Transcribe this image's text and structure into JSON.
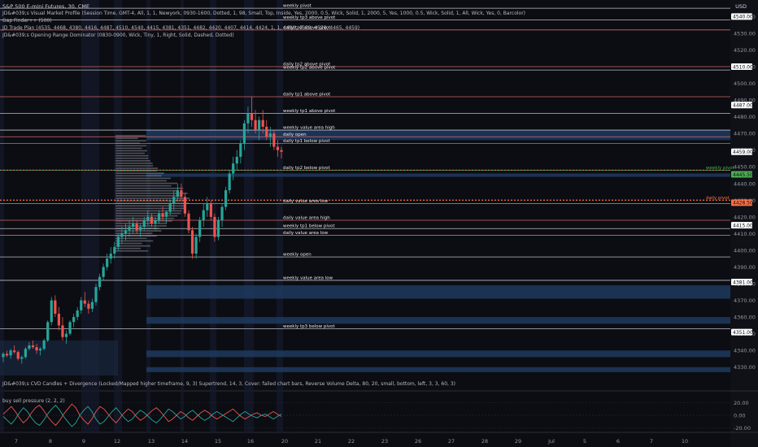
{
  "header": {
    "title": "S&P 500 E-mini Futures, 30, CME",
    "currency": "USD",
    "indicators": [
      "JD&#039;s Visual Market Profile (Session Time, GMT-4, All, 1, 1, Newyork, 0930-1600, Dotted, 1, 98, Small, Top, Inside, Yes, 2000, 0.5, Wick, Solid, 1, 2000, 5, Yes, 1000, 0.5, Wick, Solid, 1, All, Wick, Yes, 0, Barcolor)",
      "Gap Finder++ (500)",
      "JD Trade Plan (4535, 4468, 4380, 4416, 4487, 4510, 4540, 4415, 4381, 4351, 4482, 4420, 4407, 4414, 4424, 1, 1, 4498, 4509, 4528, 4465, 4459)",
      "JD&#039;s Opening Range Dominator (0830-0900, Wick, Tiny, 1, Right, Solid, Dashed, Dotted)"
    ],
    "sub_indicator": "JD&#039;s CVD Candles + Divergence (Locked/Mapped higher timeframe, 9, 3) Supertrend, 14, 3, Cover: failed chart bars, Reverse Volume Delta, 80, 20, small, bottom, left, 3, 3, 60, 3)",
    "oscillator_title": "buy sell pressure (2, 2, 2)"
  },
  "colors": {
    "background": "#0b0d12",
    "bull": "#26a69a",
    "bear": "#ef5350",
    "accent_green": "#4caf50",
    "accent_orange": "#ff7043",
    "zone_blue": "#1e3a5f"
  },
  "chart_data": {
    "type": "candlestick",
    "title": "S&P 500 E-mini Futures, 30, CME",
    "x_ticks": [
      "7",
      "8",
      "9",
      "12",
      "13",
      "14",
      "15",
      "16",
      "20",
      "21",
      "22",
      "23",
      "26",
      "27",
      "28",
      "29",
      "Jul",
      "5",
      "6",
      "7",
      "10"
    ],
    "y_ticks": [
      4330,
      4340,
      4350,
      4360,
      4370,
      4380,
      4390,
      4400,
      4410,
      4420,
      4430,
      4440,
      4450,
      4460,
      4470,
      4480,
      4490,
      4500,
      4510,
      4520,
      4530,
      4540
    ],
    "ylim": [
      4325,
      4547
    ],
    "price_tags": [
      {
        "label": "4540.00",
        "value": 4540,
        "style": "white"
      },
      {
        "label": "4510.00",
        "value": 4510,
        "style": "white"
      },
      {
        "label": "4487.00",
        "value": 4487,
        "style": "white"
      },
      {
        "label": "4459.00",
        "value": 4459,
        "style": "white"
      },
      {
        "label": "4445.50",
        "value": 4445.5,
        "style": "green"
      },
      {
        "label": "4428.50",
        "value": 4428.5,
        "style": "orange"
      },
      {
        "label": "4415.00",
        "value": 4415,
        "style": "white"
      },
      {
        "label": "4381.00",
        "value": 4381,
        "style": "white"
      },
      {
        "label": "4351.00",
        "value": 4351,
        "style": "white"
      }
    ],
    "levels": [
      {
        "label": "weekly pivot",
        "value": 4545
      },
      {
        "label": "weekly tp3 above pivot",
        "value": 4538
      },
      {
        "label": "daily tp3 above pivot",
        "value": 4532
      },
      {
        "label": "daily tp2 above pivot",
        "value": 4510
      },
      {
        "label": "weekly tp2 above pivot",
        "value": 4508
      },
      {
        "label": "daily tp1 above pivot",
        "value": 4492
      },
      {
        "label": "weekly tp1 above pivot",
        "value": 4482
      },
      {
        "label": "weekly value area high",
        "value": 4472
      },
      {
        "label": "daily open",
        "value": 4468
      },
      {
        "label": "daily tp1 below pivot",
        "value": 4464
      },
      {
        "label": "daily tp2 below pivot",
        "value": 4448
      },
      {
        "label": "weekly pivot",
        "value": 4448,
        "side": "right",
        "color": "green"
      },
      {
        "label": "daily pivot",
        "value": 4430,
        "side": "right",
        "color": "orange"
      },
      {
        "label": "daily value area low",
        "value": 4428
      },
      {
        "label": "daily value area high",
        "value": 4418
      },
      {
        "label": "weekly tp1 below pivot",
        "value": 4413
      },
      {
        "label": "daily value area low",
        "value": 4409
      },
      {
        "label": "weekly open",
        "value": 4396
      },
      {
        "label": "weekly value area low",
        "value": 4382
      },
      {
        "label": "weekly tp3 below pivot",
        "value": 4353
      }
    ],
    "zones": [
      {
        "from": 4466,
        "to": 4472,
        "color": "blue"
      },
      {
        "from": 4444,
        "to": 4446,
        "color": "blue"
      },
      {
        "from": 4371,
        "to": 4379,
        "color": "blue"
      },
      {
        "from": 4356,
        "to": 4360,
        "color": "blue"
      },
      {
        "from": 4336,
        "to": 4340,
        "color": "blue"
      },
      {
        "from": 4327,
        "to": 4330,
        "color": "blue"
      }
    ],
    "candles": [
      [
        4336,
        4339,
        4333,
        4338
      ],
      [
        4338,
        4340,
        4336,
        4337
      ],
      [
        4337,
        4341,
        4335,
        4340
      ],
      [
        4340,
        4343,
        4338,
        4339
      ],
      [
        4339,
        4340,
        4334,
        4335
      ],
      [
        4335,
        4337,
        4332,
        4336
      ],
      [
        4336,
        4342,
        4335,
        4341
      ],
      [
        4341,
        4345,
        4340,
        4343
      ],
      [
        4343,
        4346,
        4341,
        4342
      ],
      [
        4342,
        4344,
        4338,
        4340
      ],
      [
        4340,
        4342,
        4337,
        4341
      ],
      [
        4341,
        4347,
        4340,
        4346
      ],
      [
        4346,
        4358,
        4345,
        4357
      ],
      [
        4357,
        4372,
        4355,
        4370
      ],
      [
        4370,
        4373,
        4360,
        4362
      ],
      [
        4362,
        4366,
        4352,
        4355
      ],
      [
        4355,
        4360,
        4346,
        4348
      ],
      [
        4348,
        4352,
        4344,
        4350
      ],
      [
        4350,
        4358,
        4349,
        4357
      ],
      [
        4357,
        4362,
        4354,
        4360
      ],
      [
        4360,
        4366,
        4358,
        4364
      ],
      [
        4364,
        4372,
        4362,
        4370
      ],
      [
        4370,
        4375,
        4366,
        4368
      ],
      [
        4368,
        4370,
        4362,
        4365
      ],
      [
        4365,
        4371,
        4363,
        4369
      ],
      [
        4369,
        4380,
        4367,
        4378
      ],
      [
        4378,
        4386,
        4376,
        4384
      ],
      [
        4384,
        4392,
        4382,
        4390
      ],
      [
        4390,
        4398,
        4388,
        4395
      ],
      [
        4395,
        4402,
        4392,
        4398
      ],
      [
        4398,
        4405,
        4395,
        4402
      ],
      [
        4402,
        4410,
        4400,
        4408
      ],
      [
        4408,
        4414,
        4404,
        4410
      ],
      [
        4410,
        4416,
        4406,
        4412
      ],
      [
        4412,
        4418,
        4408,
        4414
      ],
      [
        4414,
        4420,
        4410,
        4416
      ],
      [
        4416,
        4418,
        4410,
        4412
      ],
      [
        4412,
        4416,
        4408,
        4414
      ],
      [
        4414,
        4420,
        4412,
        4418
      ],
      [
        4418,
        4424,
        4415,
        4420
      ],
      [
        4420,
        4422,
        4414,
        4416
      ],
      [
        4416,
        4420,
        4412,
        4418
      ],
      [
        4418,
        4424,
        4416,
        4422
      ],
      [
        4422,
        4426,
        4418,
        4420
      ],
      [
        4420,
        4424,
        4416,
        4423
      ],
      [
        4423,
        4430,
        4421,
        4428
      ],
      [
        4428,
        4436,
        4424,
        4432
      ],
      [
        4432,
        4440,
        4429,
        4436
      ],
      [
        4436,
        4440,
        4430,
        4432
      ],
      [
        4432,
        4434,
        4420,
        4422
      ],
      [
        4422,
        4424,
        4410,
        4412
      ],
      [
        4412,
        4414,
        4395,
        4398
      ],
      [
        4398,
        4410,
        4395,
        4408
      ],
      [
        4408,
        4420,
        4405,
        4418
      ],
      [
        4418,
        4428,
        4414,
        4424
      ],
      [
        4424,
        4432,
        4420,
        4428
      ],
      [
        4428,
        4430,
        4418,
        4420
      ],
      [
        4420,
        4422,
        4405,
        4408
      ],
      [
        4408,
        4420,
        4406,
        4418
      ],
      [
        4418,
        4428,
        4414,
        4426
      ],
      [
        4426,
        4438,
        4424,
        4436
      ],
      [
        4436,
        4448,
        4434,
        4446
      ],
      [
        4446,
        4456,
        4442,
        4452
      ],
      [
        4452,
        4460,
        4448,
        4456
      ],
      [
        4456,
        4466,
        4452,
        4464
      ],
      [
        4464,
        4478,
        4460,
        4476
      ],
      [
        4476,
        4486,
        4470,
        4482
      ],
      [
        4482,
        4492,
        4474,
        4478
      ],
      [
        4478,
        4484,
        4470,
        4472
      ],
      [
        4472,
        4480,
        4466,
        4478
      ],
      [
        4478,
        4484,
        4470,
        4474
      ],
      [
        4474,
        4478,
        4466,
        4468
      ],
      [
        4468,
        4474,
        4462,
        4470
      ],
      [
        4470,
        4472,
        4460,
        4462
      ],
      [
        4462,
        4466,
        4456,
        4460
      ],
      [
        4460,
        4462,
        4455,
        4459
      ]
    ],
    "oscillator": {
      "ylim": [
        -22,
        22
      ],
      "y_ticks": [
        20,
        0,
        -20
      ],
      "series": [
        {
          "color": "#ef5350",
          "values": [
            2,
            8,
            14,
            6,
            -4,
            -12,
            -6,
            4,
            12,
            16,
            8,
            -2,
            -10,
            -16,
            -8,
            2,
            10,
            18,
            12,
            0,
            -8,
            -14,
            -6,
            6,
            14,
            10,
            2,
            -6,
            -12,
            -4,
            4,
            10,
            6,
            -2,
            -8,
            -4,
            2,
            8,
            12,
            6,
            -2,
            -10,
            -6,
            0,
            6,
            2,
            -4,
            -8,
            -2,
            4,
            8,
            4,
            -2,
            -6,
            -2,
            2,
            6,
            10,
            4,
            -2,
            -6,
            -2,
            2,
            4,
            0,
            -2,
            2,
            6,
            2,
            -2
          ]
        },
        {
          "color": "#26a69a",
          "values": [
            -2,
            -8,
            -14,
            -6,
            4,
            12,
            6,
            -4,
            -12,
            -16,
            -8,
            2,
            10,
            16,
            8,
            -2,
            -10,
            -18,
            -12,
            0,
            8,
            14,
            6,
            -6,
            -14,
            -10,
            -2,
            6,
            12,
            4,
            -4,
            -10,
            -6,
            2,
            8,
            4,
            -2,
            -8,
            -12,
            -6,
            2,
            10,
            6,
            0,
            -6,
            -2,
            4,
            8,
            2,
            -4,
            -8,
            -4,
            2,
            6,
            2,
            -2,
            -6,
            -10,
            -4,
            2,
            6,
            2,
            -2,
            -4,
            0,
            2,
            -2,
            -6,
            -2,
            2
          ]
        }
      ]
    }
  }
}
